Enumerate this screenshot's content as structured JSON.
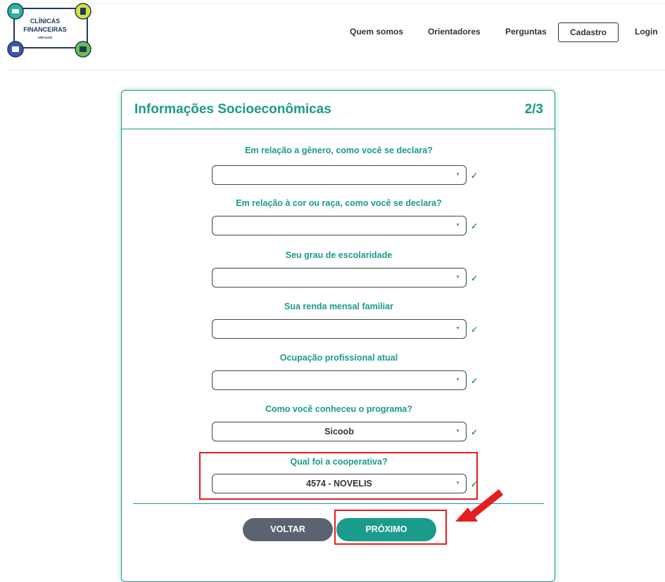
{
  "header": {
    "logo": {
      "line1": "CLÍNICAS",
      "line2": "FINANCEIRAS",
      "line3": "VIRTUAIS"
    },
    "nav": [
      {
        "label": "Quem somos"
      },
      {
        "label": "Orientadores"
      },
      {
        "label": "Perguntas"
      },
      {
        "label": "Cadastro"
      },
      {
        "label": "Login"
      }
    ]
  },
  "card": {
    "title": "Informações Socioeconômicas",
    "step": "2/3",
    "questions": [
      {
        "label": "Em relação a gênero, como você se declara?",
        "value": ""
      },
      {
        "label": "Em relação à cor ou raça, como você se declara?",
        "value": ""
      },
      {
        "label": "Seu grau de escolaridade",
        "value": ""
      },
      {
        "label": "Sua renda mensal familiar",
        "value": ""
      },
      {
        "label": "Ocupação profissional atual",
        "value": ""
      },
      {
        "label": "Como você conheceu o programa?",
        "value": "Sicoob"
      },
      {
        "label": "Qual foi a cooperativa?",
        "value": "4574 - NOVELIS"
      }
    ],
    "check_glyph": "✓",
    "buttons": {
      "back": "VOLTAR",
      "next": "PRÓXIMO"
    }
  },
  "colors": {
    "accent": "#1a9b8c",
    "back_button": "#5b6370",
    "annotation": "#e41e1e",
    "check": "#28a745"
  },
  "icons": [
    "dropdown-arrow-icon",
    "check-icon",
    "logo-wallet-icon",
    "logo-coins-icon",
    "logo-bank-icon",
    "logo-money-icon",
    "annotation-arrow-icon"
  ]
}
